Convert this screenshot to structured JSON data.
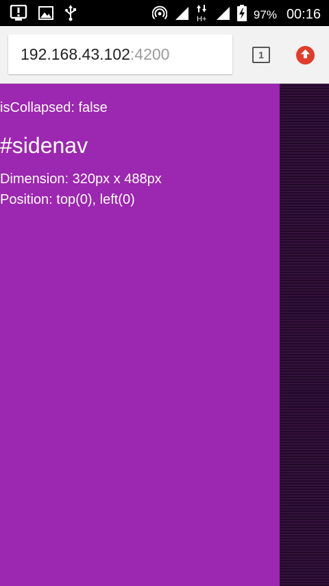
{
  "status_bar": {
    "battery_percent": "97%",
    "time": "00:16",
    "icons": [
      "download-notification-icon",
      "image-notification-icon",
      "usb-icon",
      "hotspot-icon",
      "signal-icon",
      "data-hplus-icon",
      "signal-icon",
      "battery-charging-icon"
    ]
  },
  "browser": {
    "url_host": "192.168.43.102",
    "url_port": ":4200",
    "tab_count": "1",
    "update_icon": "arrow-up-icon",
    "update_color": "#e23c2c"
  },
  "sidenav": {
    "collapsed_text": "isCollapsed: false",
    "heading": "#sidenav",
    "dimension_text": "Dimension: 320px x 488px",
    "position_text": "Position: top(0), left(0)",
    "background_color": "#9c27b0"
  }
}
